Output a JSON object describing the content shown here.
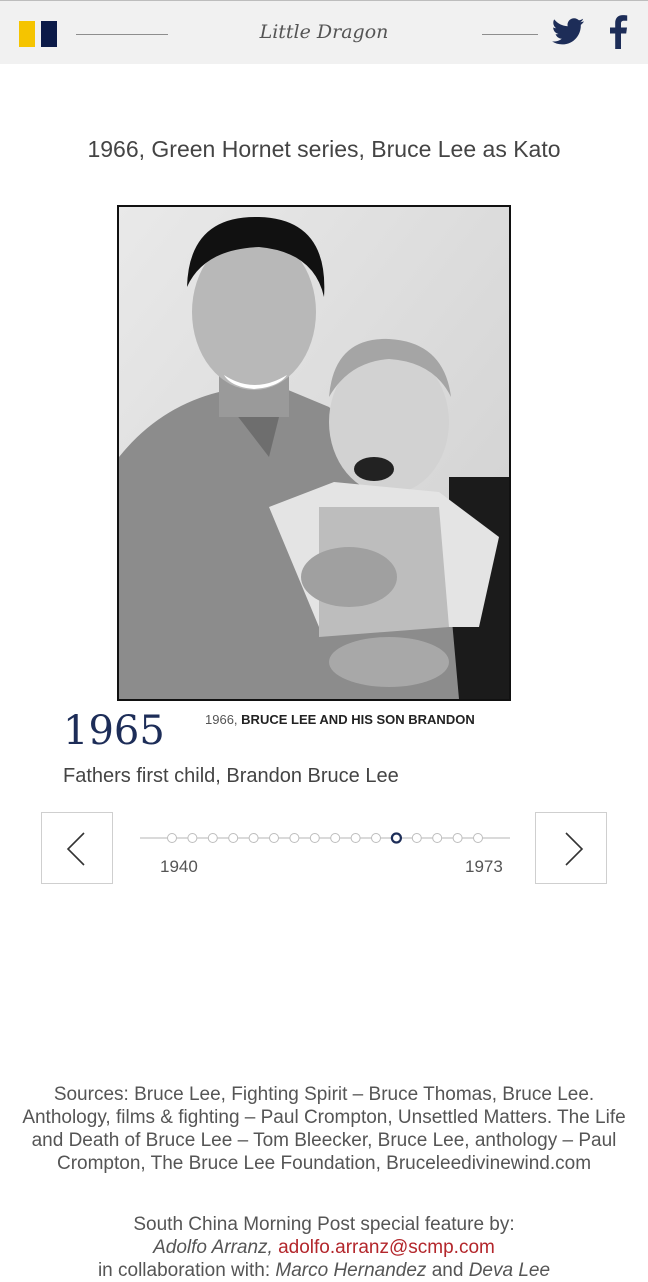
{
  "header": {
    "title": "Little Dragon"
  },
  "slide": {
    "top_caption": "1966, Green Hornet series, Bruce Lee as Kato",
    "photo_caption_year": "1966,",
    "photo_caption_text": "BRUCE LEE AND HIS SON BRANDON",
    "event_year": "1965",
    "event_description": "Fathers first child, Brandon Bruce Lee"
  },
  "timeline": {
    "start_label": "1940",
    "end_label": "1973",
    "dot_count": 16,
    "active_index": 11
  },
  "footer": {
    "sources": "Sources: Bruce Lee, Fighting Spirit – Bruce Thomas, Bruce Lee. Anthology, films & fighting – Paul Crompton, Unsettled Matters. The Life and Death of Bruce Lee – Tom Bleecker, Bruce Lee, anthology – Paul Crompton, The Bruce Lee Foundation, Bruceleedivinewind.com",
    "credit_prefix": "South China Morning Post special feature by:",
    "author_name": "Adolfo Arranz,",
    "author_email": "adolfo.arranz@scmp.com",
    "collab_prefix": "in collaboration with:",
    "collaborator_1": "Marco Hernandez",
    "collab_and": "and",
    "collaborator_2": "Deva Lee"
  },
  "colors": {
    "accent_yellow": "#f5c400",
    "accent_navy": "#0b1a48",
    "link_red": "#b3262b"
  }
}
